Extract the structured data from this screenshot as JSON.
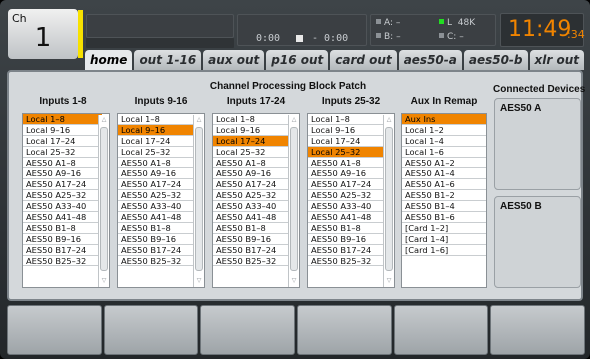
{
  "channel": {
    "label": "Ch",
    "number": "1"
  },
  "transport": {
    "elapsed": "0:00",
    "remaining": "- 0:00"
  },
  "status": {
    "a": "A:",
    "a_val": "–",
    "b": "B:",
    "b_val": "–",
    "l": "L",
    "rate": "48K",
    "c": "C:",
    "c_val": "–"
  },
  "clock": {
    "hm": "11:49",
    "sec": ":34"
  },
  "tabs": [
    "home",
    "out 1-16",
    "aux out",
    "p16 out",
    "card out",
    "aes50-a",
    "aes50-b",
    "xlr out"
  ],
  "panel": {
    "title": "Channel Processing Block Patch",
    "columns": [
      {
        "header": "Inputs 1-8",
        "items": [
          "Local 1–8",
          "Local 9–16",
          "Local 17–24",
          "Local 25–32",
          "AES50 A1–8",
          "AES50 A9–16",
          "AES50 A17–24",
          "AES50 A25–32",
          "AES50 A33–40",
          "AES50 A41–48",
          "AES50 B1–8",
          "AES50 B9–16",
          "AES50 B17–24",
          "AES50 B25–32"
        ],
        "selected": 0
      },
      {
        "header": "Inputs 9-16",
        "items": [
          "Local 1–8",
          "Local 9–16",
          "Local 17–24",
          "Local 25–32",
          "AES50 A1–8",
          "AES50 A9–16",
          "AES50 A17–24",
          "AES50 A25–32",
          "AES50 A33–40",
          "AES50 A41–48",
          "AES50 B1–8",
          "AES50 B9–16",
          "AES50 B17–24",
          "AES50 B25–32"
        ],
        "selected": 1
      },
      {
        "header": "Inputs 17-24",
        "items": [
          "Local 1–8",
          "Local 9–16",
          "Local 17–24",
          "Local 25–32",
          "AES50 A1–8",
          "AES50 A9–16",
          "AES50 A17–24",
          "AES50 A25–32",
          "AES50 A33–40",
          "AES50 A41–48",
          "AES50 B1–8",
          "AES50 B9–16",
          "AES50 B17–24",
          "AES50 B25–32"
        ],
        "selected": 2
      },
      {
        "header": "Inputs 25-32",
        "items": [
          "Local 1–8",
          "Local 9–16",
          "Local 17–24",
          "Local 25–32",
          "AES50 A1–8",
          "AES50 A9–16",
          "AES50 A17–24",
          "AES50 A25–32",
          "AES50 A33–40",
          "AES50 A41–48",
          "AES50 B1–8",
          "AES50 B9–16",
          "AES50 B17–24",
          "AES50 B25–32"
        ],
        "selected": 3
      },
      {
        "header": "Aux In Remap",
        "items": [
          "Aux Ins",
          "Local 1–2",
          "Local 1–4",
          "Local 1–6",
          "AES50 A1–2",
          "AES50 A1–4",
          "AES50 A1–6",
          "AES50 B1–2",
          "AES50 B1–4",
          "AES50 B1–6",
          "[Card 1–2]",
          "[Card 1–4]",
          "[Card 1–6]"
        ],
        "selected": 0
      }
    ],
    "connected_devices": {
      "header": "Connected Devices",
      "a": "AES50 A",
      "b": "AES50 B"
    }
  },
  "colors": {
    "accent": "#f08400",
    "channel_strip": "#f7e100",
    "led_green": "#22dd22"
  }
}
